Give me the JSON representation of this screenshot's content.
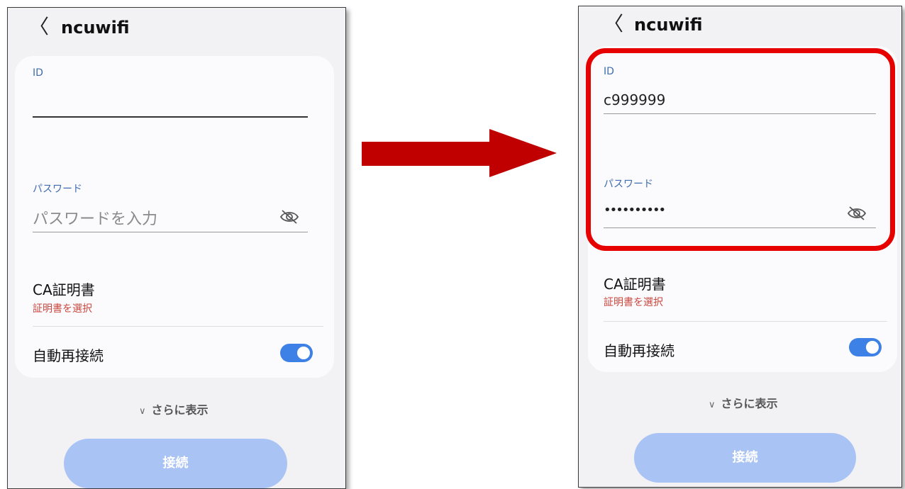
{
  "network_name": "ncuwifi",
  "back_glyph": "〈",
  "left": {
    "id_label": "ID",
    "id_value": "",
    "password_label": "パスワード",
    "password_placeholder": "パスワードを入力",
    "password_value": "",
    "ca_title": "CA証明書",
    "ca_subtitle": "証明書を選択",
    "auto_reconnect_label": "自動再接続",
    "auto_reconnect_on": true,
    "show_more_label": "さらに表示",
    "connect_label": "接続"
  },
  "right": {
    "id_label": "ID",
    "id_value": "c999999",
    "password_label": "パスワード",
    "password_value": "••••••••••",
    "ca_title": "CA証明書",
    "ca_subtitle": "証明書を選択",
    "auto_reconnect_label": "自動再接続",
    "auto_reconnect_on": true,
    "show_more_label": "さらに表示",
    "connect_label": "接続"
  },
  "icons": {
    "back": "chevron-left-icon",
    "eye": "eye-off-icon",
    "expand": "chevron-down-icon",
    "arrow": "right-arrow"
  },
  "colors": {
    "accent_blue": "#3d80e6",
    "label_blue": "#3f6cb0",
    "cert_red": "#c9473e",
    "connect_disabled": "#a9c3f4",
    "highlight_red": "#e60000",
    "arrow_red": "#c00000"
  }
}
